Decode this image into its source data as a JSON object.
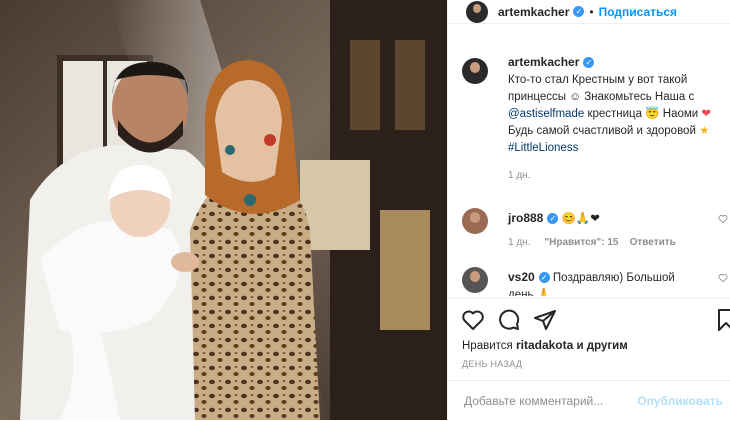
{
  "header": {
    "username": "artemkacher",
    "follow_label": "Подписаться",
    "separator": "•"
  },
  "caption": {
    "username": "artemkacher",
    "text_1": "Кто-то стал Крестным у вот такой принцессы",
    "text_2": "Знакомьтесь",
    "text_3": "Наша с",
    "mention": "@astiselfmade",
    "text_4": "крестница",
    "text_5": "Наоми",
    "text_6": "Будь самой счастливой и здоровой",
    "hashtag": "#LittleLioness",
    "time": "1 дн."
  },
  "comments": [
    {
      "username": "jro888",
      "text": "😊🙏❤",
      "time": "1 дн.",
      "likes": "\"Нравится\": 15",
      "reply": "Ответить"
    },
    {
      "username": "vs20",
      "text": "Поздравляю) Большой",
      "text_cont": "день 🙏"
    }
  ],
  "post": {
    "likes_prefix": "Нравится",
    "liked_by": "ritadakota",
    "likes_suffix": "и другим",
    "time_ago": "ДЕНЬ НАЗАД"
  },
  "add_comment": {
    "placeholder": "Добавьте комментарий...",
    "post_label": "Опубликовать"
  },
  "colors": {
    "accent": "#0095f6",
    "verified": "#3897f0",
    "heart": "#ed4956"
  },
  "icons": [
    "heart-icon",
    "comment-icon",
    "share-icon",
    "bookmark-icon",
    "verified-icon",
    "more-icon"
  ]
}
